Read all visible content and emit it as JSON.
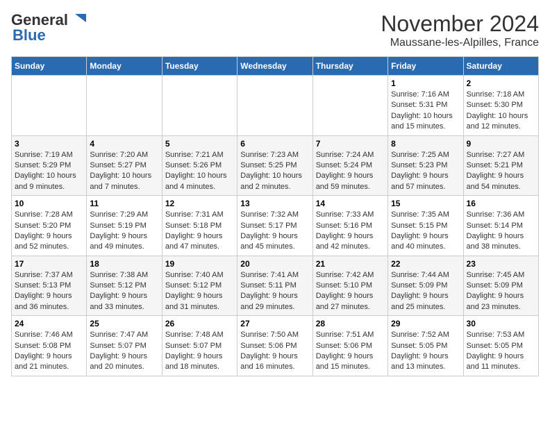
{
  "header": {
    "logo_top": "General",
    "logo_bottom": "Blue",
    "month": "November 2024",
    "location": "Maussane-les-Alpilles, France"
  },
  "weekdays": [
    "Sunday",
    "Monday",
    "Tuesday",
    "Wednesday",
    "Thursday",
    "Friday",
    "Saturday"
  ],
  "weeks": [
    [
      {
        "day": "",
        "info": ""
      },
      {
        "day": "",
        "info": ""
      },
      {
        "day": "",
        "info": ""
      },
      {
        "day": "",
        "info": ""
      },
      {
        "day": "",
        "info": ""
      },
      {
        "day": "1",
        "info": "Sunrise: 7:16 AM\nSunset: 5:31 PM\nDaylight: 10 hours and 15 minutes."
      },
      {
        "day": "2",
        "info": "Sunrise: 7:18 AM\nSunset: 5:30 PM\nDaylight: 10 hours and 12 minutes."
      }
    ],
    [
      {
        "day": "3",
        "info": "Sunrise: 7:19 AM\nSunset: 5:29 PM\nDaylight: 10 hours and 9 minutes."
      },
      {
        "day": "4",
        "info": "Sunrise: 7:20 AM\nSunset: 5:27 PM\nDaylight: 10 hours and 7 minutes."
      },
      {
        "day": "5",
        "info": "Sunrise: 7:21 AM\nSunset: 5:26 PM\nDaylight: 10 hours and 4 minutes."
      },
      {
        "day": "6",
        "info": "Sunrise: 7:23 AM\nSunset: 5:25 PM\nDaylight: 10 hours and 2 minutes."
      },
      {
        "day": "7",
        "info": "Sunrise: 7:24 AM\nSunset: 5:24 PM\nDaylight: 9 hours and 59 minutes."
      },
      {
        "day": "8",
        "info": "Sunrise: 7:25 AM\nSunset: 5:23 PM\nDaylight: 9 hours and 57 minutes."
      },
      {
        "day": "9",
        "info": "Sunrise: 7:27 AM\nSunset: 5:21 PM\nDaylight: 9 hours and 54 minutes."
      }
    ],
    [
      {
        "day": "10",
        "info": "Sunrise: 7:28 AM\nSunset: 5:20 PM\nDaylight: 9 hours and 52 minutes."
      },
      {
        "day": "11",
        "info": "Sunrise: 7:29 AM\nSunset: 5:19 PM\nDaylight: 9 hours and 49 minutes."
      },
      {
        "day": "12",
        "info": "Sunrise: 7:31 AM\nSunset: 5:18 PM\nDaylight: 9 hours and 47 minutes."
      },
      {
        "day": "13",
        "info": "Sunrise: 7:32 AM\nSunset: 5:17 PM\nDaylight: 9 hours and 45 minutes."
      },
      {
        "day": "14",
        "info": "Sunrise: 7:33 AM\nSunset: 5:16 PM\nDaylight: 9 hours and 42 minutes."
      },
      {
        "day": "15",
        "info": "Sunrise: 7:35 AM\nSunset: 5:15 PM\nDaylight: 9 hours and 40 minutes."
      },
      {
        "day": "16",
        "info": "Sunrise: 7:36 AM\nSunset: 5:14 PM\nDaylight: 9 hours and 38 minutes."
      }
    ],
    [
      {
        "day": "17",
        "info": "Sunrise: 7:37 AM\nSunset: 5:13 PM\nDaylight: 9 hours and 36 minutes."
      },
      {
        "day": "18",
        "info": "Sunrise: 7:38 AM\nSunset: 5:12 PM\nDaylight: 9 hours and 33 minutes."
      },
      {
        "day": "19",
        "info": "Sunrise: 7:40 AM\nSunset: 5:12 PM\nDaylight: 9 hours and 31 minutes."
      },
      {
        "day": "20",
        "info": "Sunrise: 7:41 AM\nSunset: 5:11 PM\nDaylight: 9 hours and 29 minutes."
      },
      {
        "day": "21",
        "info": "Sunrise: 7:42 AM\nSunset: 5:10 PM\nDaylight: 9 hours and 27 minutes."
      },
      {
        "day": "22",
        "info": "Sunrise: 7:44 AM\nSunset: 5:09 PM\nDaylight: 9 hours and 25 minutes."
      },
      {
        "day": "23",
        "info": "Sunrise: 7:45 AM\nSunset: 5:09 PM\nDaylight: 9 hours and 23 minutes."
      }
    ],
    [
      {
        "day": "24",
        "info": "Sunrise: 7:46 AM\nSunset: 5:08 PM\nDaylight: 9 hours and 21 minutes."
      },
      {
        "day": "25",
        "info": "Sunrise: 7:47 AM\nSunset: 5:07 PM\nDaylight: 9 hours and 20 minutes."
      },
      {
        "day": "26",
        "info": "Sunrise: 7:48 AM\nSunset: 5:07 PM\nDaylight: 9 hours and 18 minutes."
      },
      {
        "day": "27",
        "info": "Sunrise: 7:50 AM\nSunset: 5:06 PM\nDaylight: 9 hours and 16 minutes."
      },
      {
        "day": "28",
        "info": "Sunrise: 7:51 AM\nSunset: 5:06 PM\nDaylight: 9 hours and 15 minutes."
      },
      {
        "day": "29",
        "info": "Sunrise: 7:52 AM\nSunset: 5:05 PM\nDaylight: 9 hours and 13 minutes."
      },
      {
        "day": "30",
        "info": "Sunrise: 7:53 AM\nSunset: 5:05 PM\nDaylight: 9 hours and 11 minutes."
      }
    ]
  ]
}
